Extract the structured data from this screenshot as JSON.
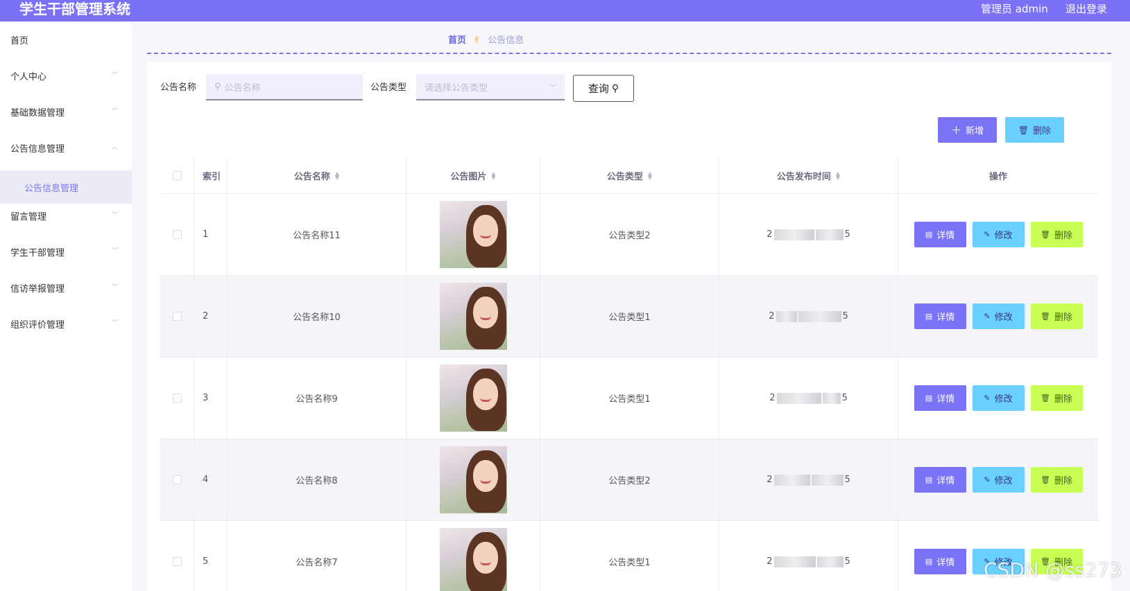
{
  "app": {
    "title": "学生干部管理系统"
  },
  "user": {
    "greeting": "管理员 admin",
    "logout": "退出登录"
  },
  "sidebar": {
    "items": [
      {
        "label": "首页",
        "expandable": false
      },
      {
        "label": "个人中心",
        "expandable": true
      },
      {
        "label": "基础数据管理",
        "expandable": true
      },
      {
        "label": "公告信息管理",
        "expandable": true,
        "expanded": true
      },
      {
        "label": "留言管理",
        "expandable": true
      },
      {
        "label": "学生干部管理",
        "expandable": true
      },
      {
        "label": "信访举报管理",
        "expandable": true
      },
      {
        "label": "组织评价管理",
        "expandable": true
      }
    ],
    "active_sub": "公告信息管理"
  },
  "breadcrumb": {
    "home": "首页",
    "current": "公告信息"
  },
  "filters": {
    "name_label": "公告名称",
    "name_placeholder": "公告名称",
    "type_label": "公告类型",
    "type_placeholder": "请选择公告类型",
    "query_label": "查询"
  },
  "actions": {
    "add": "新增",
    "delete": "删除"
  },
  "table": {
    "columns": [
      "索引",
      "公告名称",
      "公告图片",
      "公告类型",
      "公告发布时间",
      "操作"
    ],
    "row_buttons": {
      "detail": "详情",
      "edit": "修改",
      "delete": "删除"
    },
    "rows": [
      {
        "index": "1",
        "name": "公告名称11",
        "type": "公告类型2",
        "time_start": "2",
        "time_end": "5"
      },
      {
        "index": "2",
        "name": "公告名称10",
        "type": "公告类型1",
        "time_start": "2",
        "time_end": "5"
      },
      {
        "index": "3",
        "name": "公告名称9",
        "type": "公告类型1",
        "time_start": "2",
        "time_end": "5"
      },
      {
        "index": "4",
        "name": "公告名称8",
        "type": "公告类型2",
        "time_start": "2",
        "time_end": "5"
      },
      {
        "index": "5",
        "name": "公告名称7",
        "type": "公告类型1",
        "time_start": "2",
        "time_end": "5"
      }
    ]
  },
  "watermark": "CSDN @ss273",
  "colors": {
    "primary": "#7a71f7",
    "info": "#6ad1ff",
    "success": "#c8ff55"
  }
}
